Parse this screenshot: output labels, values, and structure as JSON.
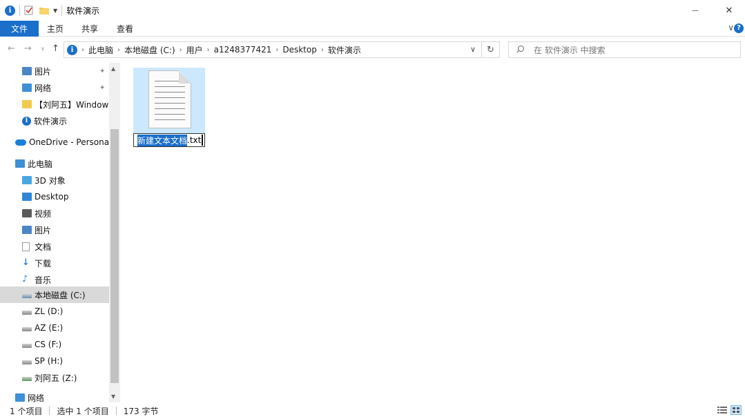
{
  "window": {
    "title": "软件演示",
    "minimize_glyph": "—",
    "close_glyph": "✕"
  },
  "ribbon": {
    "tabs": [
      "文件",
      "主页",
      "共享",
      "查看"
    ],
    "expand_glyph": "∨",
    "help_glyph": "?"
  },
  "address": {
    "crumbs": [
      "此电脑",
      "本地磁盘 (C:)",
      "用户",
      "a1248377421",
      "Desktop",
      "软件演示"
    ],
    "separator": "›",
    "dropdown_glyph": "∨",
    "refresh_glyph": "↻"
  },
  "search": {
    "placeholder": "在 软件演示 中搜索"
  },
  "nav": {
    "items": [
      {
        "label": "图片",
        "icon": "pictures-icon",
        "pinned": true
      },
      {
        "label": "网络",
        "icon": "network-icon",
        "pinned": true
      },
      {
        "label": "【刘阿五】Windows",
        "icon": "folder-icon",
        "pinned": false
      },
      {
        "label": "软件演示",
        "icon": "info-folder-icon",
        "pinned": false
      },
      {
        "label": "OneDrive - Personal",
        "icon": "onedrive-icon",
        "pinned": false
      },
      {
        "label": "此电脑",
        "icon": "this-pc-icon",
        "pinned": false
      },
      {
        "label": "3D 对象",
        "icon": "3d-objects-icon",
        "pinned": false
      },
      {
        "label": "Desktop",
        "icon": "desktop-icon",
        "pinned": false
      },
      {
        "label": "视频",
        "icon": "videos-icon",
        "pinned": false
      },
      {
        "label": "图片",
        "icon": "pictures-icon",
        "pinned": false
      },
      {
        "label": "文档",
        "icon": "documents-icon",
        "pinned": false
      },
      {
        "label": "下载",
        "icon": "downloads-icon",
        "pinned": false
      },
      {
        "label": "音乐",
        "icon": "music-icon",
        "pinned": false
      },
      {
        "label": "本地磁盘 (C:)",
        "icon": "drive-c-icon",
        "pinned": false,
        "selected": true
      },
      {
        "label": "ZL (D:)",
        "icon": "drive-icon",
        "pinned": false
      },
      {
        "label": "AZ (E:)",
        "icon": "drive-icon",
        "pinned": false
      },
      {
        "label": "CS (F:)",
        "icon": "drive-icon",
        "pinned": false
      },
      {
        "label": "SP (H:)",
        "icon": "drive-icon",
        "pinned": false
      },
      {
        "label": "刘阿五 (Z:)",
        "icon": "network-drive-icon",
        "pinned": false
      },
      {
        "label": "网络",
        "icon": "network-icon",
        "pinned": false
      }
    ],
    "pin_glyph": "✦"
  },
  "file": {
    "name_selected": "新建文本文档",
    "name_ext": ".txt"
  },
  "status": {
    "item_count": "1 个项目",
    "selected": "选中 1 个项目",
    "size": "173 字节"
  },
  "colors": {
    "accent": "#1a6fc9",
    "selection_bg": "#cce8ff",
    "nav_selected_bg": "#d9d9d9"
  }
}
